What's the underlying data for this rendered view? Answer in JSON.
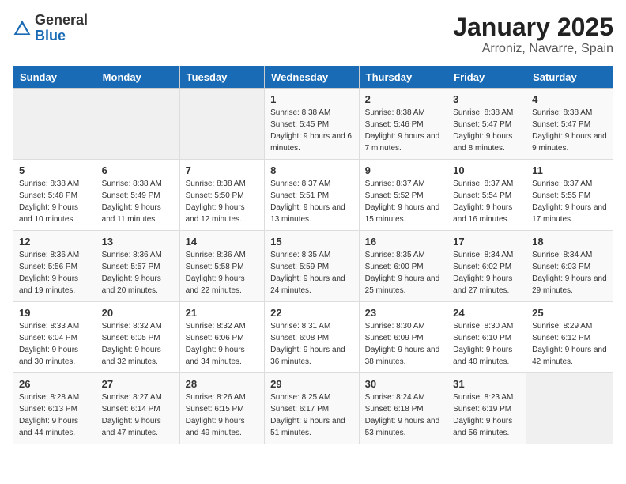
{
  "logo": {
    "general": "General",
    "blue": "Blue"
  },
  "title": "January 2025",
  "subtitle": "Arroniz, Navarre, Spain",
  "weekdays": [
    "Sunday",
    "Monday",
    "Tuesday",
    "Wednesday",
    "Thursday",
    "Friday",
    "Saturday"
  ],
  "rows": [
    [
      {
        "day": "",
        "sunrise": "",
        "sunset": "",
        "daylight": ""
      },
      {
        "day": "",
        "sunrise": "",
        "sunset": "",
        "daylight": ""
      },
      {
        "day": "",
        "sunrise": "",
        "sunset": "",
        "daylight": ""
      },
      {
        "day": "1",
        "sunrise": "Sunrise: 8:38 AM",
        "sunset": "Sunset: 5:45 PM",
        "daylight": "Daylight: 9 hours and 6 minutes."
      },
      {
        "day": "2",
        "sunrise": "Sunrise: 8:38 AM",
        "sunset": "Sunset: 5:46 PM",
        "daylight": "Daylight: 9 hours and 7 minutes."
      },
      {
        "day": "3",
        "sunrise": "Sunrise: 8:38 AM",
        "sunset": "Sunset: 5:47 PM",
        "daylight": "Daylight: 9 hours and 8 minutes."
      },
      {
        "day": "4",
        "sunrise": "Sunrise: 8:38 AM",
        "sunset": "Sunset: 5:47 PM",
        "daylight": "Daylight: 9 hours and 9 minutes."
      }
    ],
    [
      {
        "day": "5",
        "sunrise": "Sunrise: 8:38 AM",
        "sunset": "Sunset: 5:48 PM",
        "daylight": "Daylight: 9 hours and 10 minutes."
      },
      {
        "day": "6",
        "sunrise": "Sunrise: 8:38 AM",
        "sunset": "Sunset: 5:49 PM",
        "daylight": "Daylight: 9 hours and 11 minutes."
      },
      {
        "day": "7",
        "sunrise": "Sunrise: 8:38 AM",
        "sunset": "Sunset: 5:50 PM",
        "daylight": "Daylight: 9 hours and 12 minutes."
      },
      {
        "day": "8",
        "sunrise": "Sunrise: 8:37 AM",
        "sunset": "Sunset: 5:51 PM",
        "daylight": "Daylight: 9 hours and 13 minutes."
      },
      {
        "day": "9",
        "sunrise": "Sunrise: 8:37 AM",
        "sunset": "Sunset: 5:52 PM",
        "daylight": "Daylight: 9 hours and 15 minutes."
      },
      {
        "day": "10",
        "sunrise": "Sunrise: 8:37 AM",
        "sunset": "Sunset: 5:54 PM",
        "daylight": "Daylight: 9 hours and 16 minutes."
      },
      {
        "day": "11",
        "sunrise": "Sunrise: 8:37 AM",
        "sunset": "Sunset: 5:55 PM",
        "daylight": "Daylight: 9 hours and 17 minutes."
      }
    ],
    [
      {
        "day": "12",
        "sunrise": "Sunrise: 8:36 AM",
        "sunset": "Sunset: 5:56 PM",
        "daylight": "Daylight: 9 hours and 19 minutes."
      },
      {
        "day": "13",
        "sunrise": "Sunrise: 8:36 AM",
        "sunset": "Sunset: 5:57 PM",
        "daylight": "Daylight: 9 hours and 20 minutes."
      },
      {
        "day": "14",
        "sunrise": "Sunrise: 8:36 AM",
        "sunset": "Sunset: 5:58 PM",
        "daylight": "Daylight: 9 hours and 22 minutes."
      },
      {
        "day": "15",
        "sunrise": "Sunrise: 8:35 AM",
        "sunset": "Sunset: 5:59 PM",
        "daylight": "Daylight: 9 hours and 24 minutes."
      },
      {
        "day": "16",
        "sunrise": "Sunrise: 8:35 AM",
        "sunset": "Sunset: 6:00 PM",
        "daylight": "Daylight: 9 hours and 25 minutes."
      },
      {
        "day": "17",
        "sunrise": "Sunrise: 8:34 AM",
        "sunset": "Sunset: 6:02 PM",
        "daylight": "Daylight: 9 hours and 27 minutes."
      },
      {
        "day": "18",
        "sunrise": "Sunrise: 8:34 AM",
        "sunset": "Sunset: 6:03 PM",
        "daylight": "Daylight: 9 hours and 29 minutes."
      }
    ],
    [
      {
        "day": "19",
        "sunrise": "Sunrise: 8:33 AM",
        "sunset": "Sunset: 6:04 PM",
        "daylight": "Daylight: 9 hours and 30 minutes."
      },
      {
        "day": "20",
        "sunrise": "Sunrise: 8:32 AM",
        "sunset": "Sunset: 6:05 PM",
        "daylight": "Daylight: 9 hours and 32 minutes."
      },
      {
        "day": "21",
        "sunrise": "Sunrise: 8:32 AM",
        "sunset": "Sunset: 6:06 PM",
        "daylight": "Daylight: 9 hours and 34 minutes."
      },
      {
        "day": "22",
        "sunrise": "Sunrise: 8:31 AM",
        "sunset": "Sunset: 6:08 PM",
        "daylight": "Daylight: 9 hours and 36 minutes."
      },
      {
        "day": "23",
        "sunrise": "Sunrise: 8:30 AM",
        "sunset": "Sunset: 6:09 PM",
        "daylight": "Daylight: 9 hours and 38 minutes."
      },
      {
        "day": "24",
        "sunrise": "Sunrise: 8:30 AM",
        "sunset": "Sunset: 6:10 PM",
        "daylight": "Daylight: 9 hours and 40 minutes."
      },
      {
        "day": "25",
        "sunrise": "Sunrise: 8:29 AM",
        "sunset": "Sunset: 6:12 PM",
        "daylight": "Daylight: 9 hours and 42 minutes."
      }
    ],
    [
      {
        "day": "26",
        "sunrise": "Sunrise: 8:28 AM",
        "sunset": "Sunset: 6:13 PM",
        "daylight": "Daylight: 9 hours and 44 minutes."
      },
      {
        "day": "27",
        "sunrise": "Sunrise: 8:27 AM",
        "sunset": "Sunset: 6:14 PM",
        "daylight": "Daylight: 9 hours and 47 minutes."
      },
      {
        "day": "28",
        "sunrise": "Sunrise: 8:26 AM",
        "sunset": "Sunset: 6:15 PM",
        "daylight": "Daylight: 9 hours and 49 minutes."
      },
      {
        "day": "29",
        "sunrise": "Sunrise: 8:25 AM",
        "sunset": "Sunset: 6:17 PM",
        "daylight": "Daylight: 9 hours and 51 minutes."
      },
      {
        "day": "30",
        "sunrise": "Sunrise: 8:24 AM",
        "sunset": "Sunset: 6:18 PM",
        "daylight": "Daylight: 9 hours and 53 minutes."
      },
      {
        "day": "31",
        "sunrise": "Sunrise: 8:23 AM",
        "sunset": "Sunset: 6:19 PM",
        "daylight": "Daylight: 9 hours and 56 minutes."
      },
      {
        "day": "",
        "sunrise": "",
        "sunset": "",
        "daylight": ""
      }
    ]
  ]
}
